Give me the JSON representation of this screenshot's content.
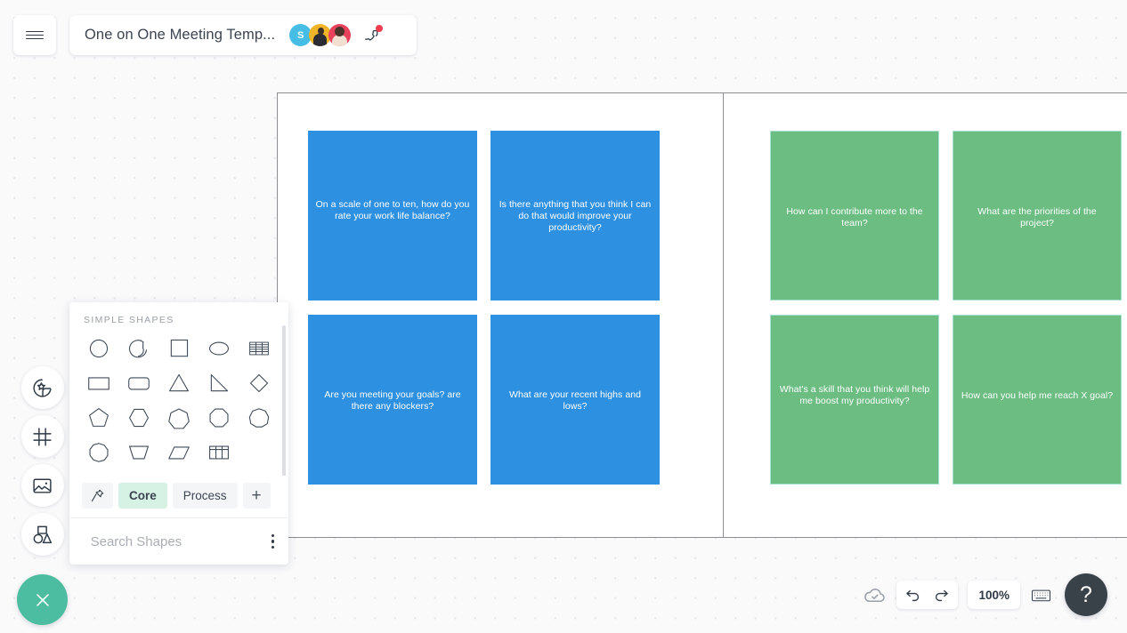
{
  "header": {
    "menu_icon": "hamburger-menu-icon",
    "doc_title": "One on One Meeting Temp...",
    "avatars": [
      {
        "name": "avatar-s",
        "initial": "S"
      },
      {
        "name": "avatar-photo-1",
        "initial": ""
      },
      {
        "name": "avatar-photo-2",
        "initial": ""
      }
    ],
    "call_icon": "phone-call-icon",
    "call_badge": true
  },
  "left_rail": {
    "items": [
      {
        "name": "sticker-icon",
        "label": "Stickers"
      },
      {
        "name": "frame-icon",
        "label": "Frames"
      },
      {
        "name": "image-icon",
        "label": "Images"
      },
      {
        "name": "shapes-icon",
        "label": "Shapes"
      }
    ],
    "close_button": {
      "name": "close-icon",
      "label": "Close"
    }
  },
  "shapes_panel": {
    "heading": "SIMPLE SHAPES",
    "shapes": [
      "circle-shape",
      "arc-shape",
      "square-shape",
      "ellipse-shape",
      "table-striped-shape",
      "rectangle-shape",
      "rounded-rectangle-shape",
      "triangle-shape",
      "right-triangle-shape",
      "diamond-shape",
      "pentagon-shape",
      "hexagon-shape",
      "heptagon-shape",
      "octagon-shape",
      "nonagon-shape",
      "decagon-shape",
      "trapezoid-shape",
      "parallelogram-shape",
      "grid-table-shape"
    ],
    "tabs": [
      {
        "name": "tab-pinned",
        "label": "",
        "icon": "pin-icon",
        "active": false
      },
      {
        "name": "tab-core",
        "label": "Core",
        "icon": "",
        "active": true
      },
      {
        "name": "tab-process",
        "label": "Process",
        "icon": "",
        "active": false
      },
      {
        "name": "tab-add",
        "label": "+",
        "icon": "plus-icon",
        "active": false
      }
    ],
    "search": {
      "placeholder": "Search Shapes",
      "value": "",
      "icon": "search-icon",
      "more_icon": "more-vertical-icon"
    }
  },
  "canvas": {
    "notes": [
      {
        "id": "note-1",
        "color": "blue",
        "text": "On a scale of one to ten, how do you rate your work life balance?"
      },
      {
        "id": "note-2",
        "color": "blue",
        "text": "Is there anything that you think I can do that would improve your productivity?"
      },
      {
        "id": "note-3",
        "color": "blue",
        "text": "Are you meeting your goals? are there any blockers?"
      },
      {
        "id": "note-4",
        "color": "blue",
        "text": "What are your recent highs and lows?"
      },
      {
        "id": "note-5",
        "color": "green",
        "text": "How can I contribute more to the team?"
      },
      {
        "id": "note-6",
        "color": "green",
        "text": "What are the priorities of the project?"
      },
      {
        "id": "note-7",
        "color": "green",
        "text": "What's a skill that you think will help me boost my productivity?"
      },
      {
        "id": "note-8",
        "color": "green",
        "text": "How can you help me reach X goal?"
      }
    ]
  },
  "bottom_bar": {
    "cloud_icon": "cloud-saved-icon",
    "undo_icon": "undo-icon",
    "redo_icon": "redo-icon",
    "zoom_level": "100%",
    "keyboard_icon": "keyboard-shortcuts-icon",
    "help_label": "?"
  },
  "colors": {
    "note_blue": "#2e90e0",
    "note_green": "#6bbd82",
    "note_green_border": "#a7dfd0",
    "accent_teal": "#4cbda0",
    "tab_active_bg": "#d6f2e4",
    "help_fab_bg": "#3a4249",
    "call_badge": "#ef3d4e"
  }
}
